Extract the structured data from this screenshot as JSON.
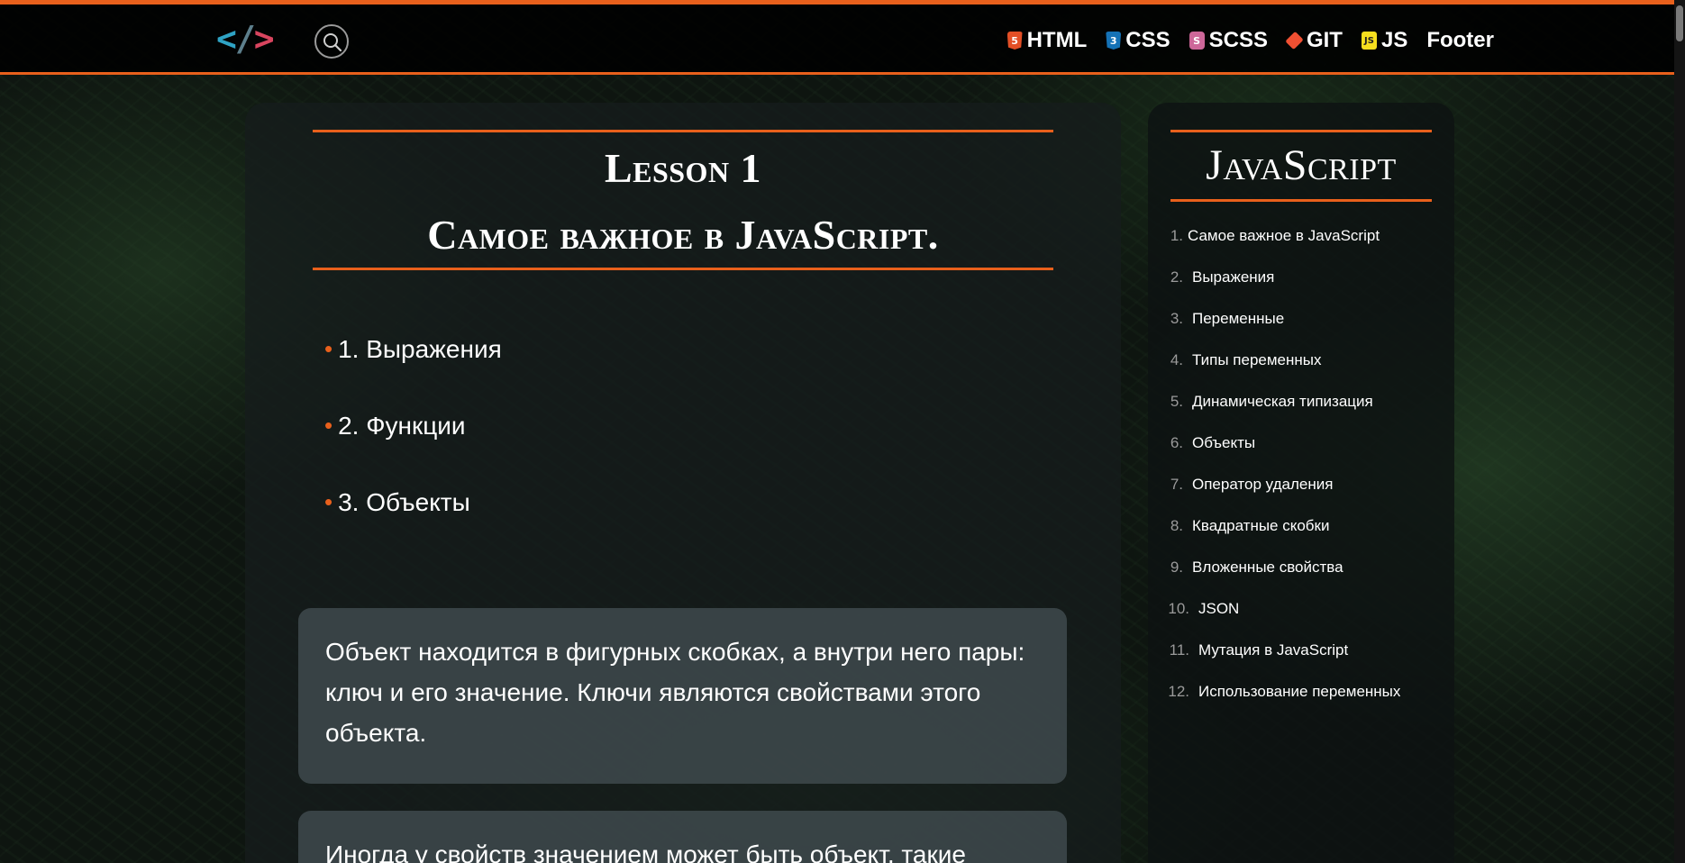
{
  "header": {
    "logo": {
      "lt": "<",
      "slash": "/",
      "gt": ">"
    },
    "nav": [
      {
        "label": "HTML",
        "icon": "html5-icon",
        "icon_text": "5"
      },
      {
        "label": "CSS",
        "icon": "css3-icon",
        "icon_text": "3"
      },
      {
        "label": "SCSS",
        "icon": "sass-icon",
        "icon_text": "S"
      },
      {
        "label": "GIT",
        "icon": "git-icon",
        "icon_text": ""
      },
      {
        "label": "JS",
        "icon": "js-icon",
        "icon_text": "JS"
      },
      {
        "label": "Footer"
      }
    ]
  },
  "main": {
    "lesson_title": "Lesson 1",
    "lesson_subtitle": "Самое важное в JavaScript.",
    "topics": [
      "1. Выражения",
      "2. Функции",
      "3. Объекты"
    ],
    "cards": [
      "Объект находится в фигурных скобках, а внутри него пары: ключ и его значение. Ключи являются свойствами этого объекта.",
      "Иногда у свойств значением может быть объект, такие"
    ]
  },
  "sidebar": {
    "title": "JavaScript",
    "items": [
      {
        "num": "1.",
        "label": "Самое важное в JavaScript"
      },
      {
        "num": "2.",
        "label": "Выражения"
      },
      {
        "num": "3.",
        "label": "Переменные"
      },
      {
        "num": "4.",
        "label": "Типы переменных"
      },
      {
        "num": "5.",
        "label": "Динамическая типизация"
      },
      {
        "num": "6.",
        "label": "Объекты"
      },
      {
        "num": "7.",
        "label": "Оператор удаления"
      },
      {
        "num": "8.",
        "label": "Квадратные скобки"
      },
      {
        "num": "9.",
        "label": "Вложенные свойства"
      },
      {
        "num": "10.",
        "label": "JSON"
      },
      {
        "num": "11.",
        "label": "Мутация в JavaScript"
      },
      {
        "num": "12.",
        "label": "Использование переменных"
      }
    ]
  },
  "colors": {
    "accent": "#e8601c",
    "logo_lt": "#2fa3c4",
    "logo_gt": "#d9455f"
  }
}
